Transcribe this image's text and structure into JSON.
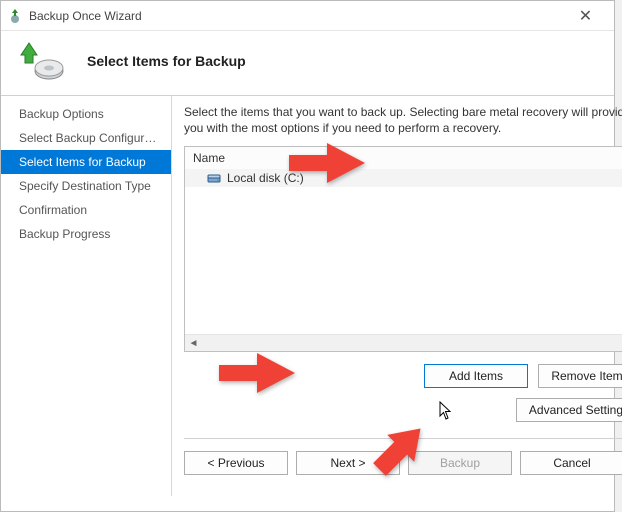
{
  "window": {
    "title": "Backup Once Wizard"
  },
  "header": {
    "heading": "Select Items for Backup"
  },
  "sidebar": {
    "items": [
      {
        "label": "Backup Options"
      },
      {
        "label": "Select Backup Configurat..."
      },
      {
        "label": "Select Items for Backup"
      },
      {
        "label": "Specify Destination Type"
      },
      {
        "label": "Confirmation"
      },
      {
        "label": "Backup Progress"
      }
    ],
    "selected_index": 2
  },
  "main": {
    "instruction": "Select the items that you want to back up. Selecting bare metal recovery will provide you with the most options if you need to perform a recovery.",
    "list": {
      "header": "Name",
      "items": [
        {
          "label": "Local disk (C:)"
        }
      ]
    },
    "buttons": {
      "add_items": "Add Items",
      "remove_items": "Remove Items",
      "advanced": "Advanced Settings"
    }
  },
  "wizard_buttons": {
    "previous": "< Previous",
    "next": "Next >",
    "backup": "Backup",
    "cancel": "Cancel"
  }
}
